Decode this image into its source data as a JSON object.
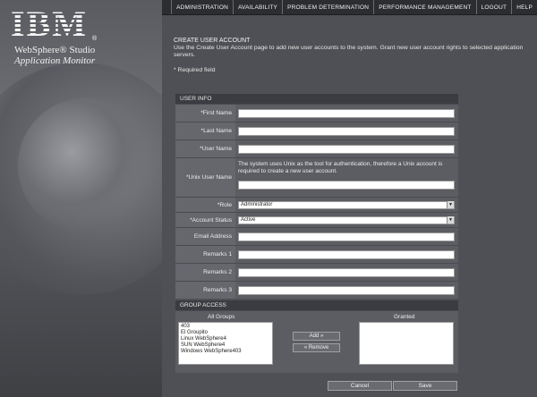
{
  "brand": {
    "logo": "IBM",
    "logo_reg": "®",
    "product_line1": "WebSphere® Studio",
    "product_line2": "Application Monitor"
  },
  "topnav": [
    "ADMINISTRATION",
    "AVAILABILITY",
    "PROBLEM DETERMINATION",
    "PERFORMANCE MANAGEMENT",
    "LOGOUT",
    "HELP"
  ],
  "intro": {
    "title": "CREATE USER ACCOUNT",
    "description": "Use the Create User Account page to add new user accounts to the system. Grant new user account rights to selected application servers.",
    "required": "* Required field"
  },
  "user_info": {
    "header": "USER INFO",
    "first_name": "*First Name",
    "last_name": "*Last Name",
    "user_name": "*User Name",
    "unix_user_name": "*Unix User Name",
    "unix_note": "The system uses Unix as the tool for authentication, therefore a Unix account is required to create a new user account.",
    "role_label": "*Role",
    "role_value": "Administrator",
    "status_label": "*Account Status",
    "status_value": "Active",
    "email": "Email Address",
    "remarks1": "Remarks 1",
    "remarks2": "Remarks 2",
    "remarks3": "Remarks 3"
  },
  "group_access": {
    "header": "GROUP ACCESS",
    "all_groups_label": "All Groups",
    "granted_label": "Granted",
    "all_groups": [
      "403",
      "El Groupito",
      "Linux WebSphere4",
      "SUN WebSphere4",
      "Windows WebSphere403"
    ],
    "add_label": "Add »",
    "remove_label": "« Remove"
  },
  "actions": {
    "cancel": "Cancel",
    "save": "Save"
  },
  "colors": {
    "nav_bg": "#2c2d31",
    "panel_bg": "#5c5d62",
    "label_bg": "#66676d"
  },
  "icons": {
    "dropdown": "chevron-down-icon"
  }
}
